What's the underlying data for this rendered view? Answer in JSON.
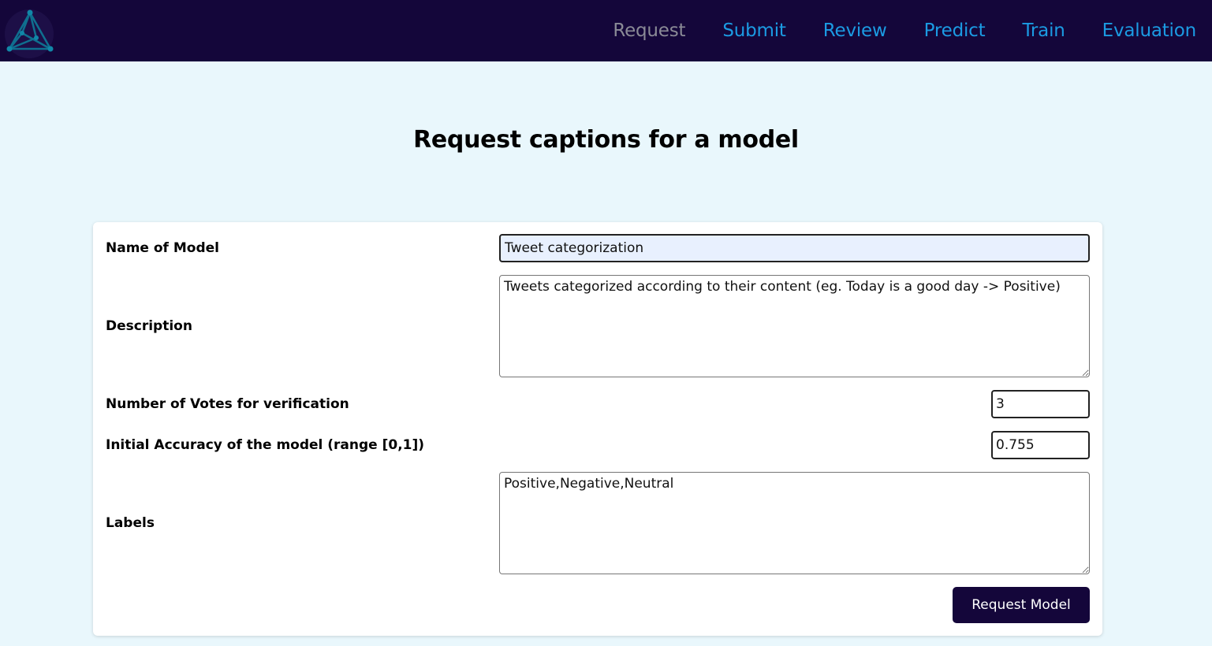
{
  "nav": {
    "items": [
      {
        "label": "Request",
        "active": true
      },
      {
        "label": "Submit",
        "active": false
      },
      {
        "label": "Review",
        "active": false
      },
      {
        "label": "Predict",
        "active": false
      },
      {
        "label": "Train",
        "active": false
      },
      {
        "label": "Evaluation",
        "active": false
      }
    ]
  },
  "page": {
    "title": "Request captions for a model"
  },
  "form": {
    "name": {
      "label": "Name of Model",
      "value": "Tweet categorization"
    },
    "description": {
      "label": "Description",
      "value": "Tweets categorized according to their content (eg. Today is a good day -> Positive)"
    },
    "votes": {
      "label": "Number of Votes for verification",
      "value": "3"
    },
    "accuracy": {
      "label": "Initial Accuracy of the model (range [0,1])",
      "value": "0.755"
    },
    "labels": {
      "label": "Labels",
      "value": "Positive,Negative,Neutral"
    },
    "submit_label": "Request Model"
  },
  "colors": {
    "navbar_bg": "#14063a",
    "nav_link": "#1b9be3",
    "nav_active": "#8a8a96",
    "page_bg": "#e9f7fc",
    "button_bg": "#14063a"
  },
  "icons": {
    "logo": "network-triangle-logo-icon"
  }
}
